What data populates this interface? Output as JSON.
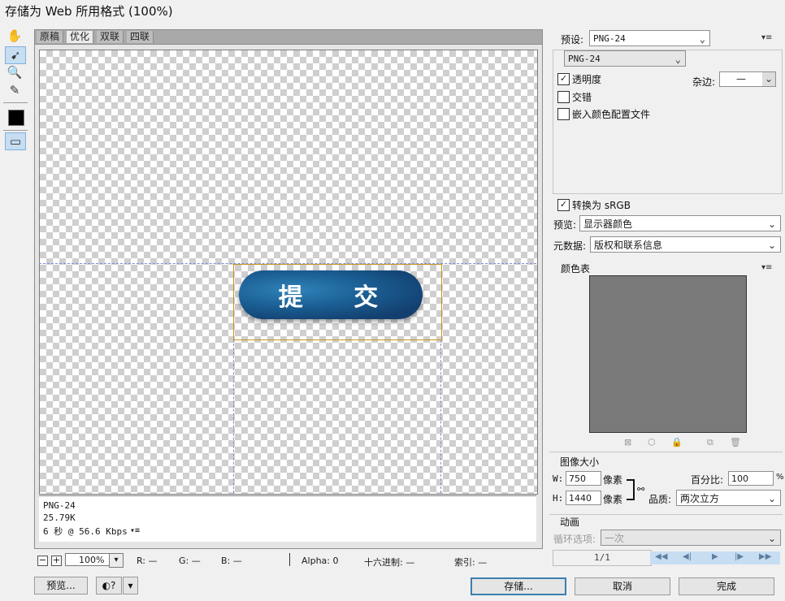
{
  "window": {
    "title": "存储为 Web 所用格式 (100%)"
  },
  "tabs": [
    {
      "label": "原稿",
      "active": false
    },
    {
      "label": "优化",
      "active": true
    },
    {
      "label": "双联",
      "active": false
    },
    {
      "label": "四联",
      "active": false
    }
  ],
  "canvas": {
    "button_text": "提 交"
  },
  "info": {
    "format": "PNG-24",
    "size": "25.79K",
    "time": "6 秒 @ 56.6 Kbps"
  },
  "status": {
    "zoom": "100%",
    "r": "R: —",
    "g": "G: —",
    "b": "B: —",
    "alpha": "Alpha: 0",
    "hex": "十六进制: —",
    "index": "索引: —"
  },
  "buttons": {
    "preview": "预览...",
    "save": "存储...",
    "cancel": "取消",
    "done": "完成"
  },
  "settings": {
    "preset_label": "预设:",
    "preset_value": "PNG-24",
    "format_value": "PNG-24",
    "transparency_label": "透明度",
    "transparency_checked": true,
    "matte_label": "杂边:",
    "matte_value": "—",
    "interlaced_label": "交错",
    "interlaced_checked": false,
    "embed_profile_label": "嵌入颜色配置文件",
    "embed_profile_checked": false,
    "convert_srgb_label": "转换为 sRGB",
    "convert_srgb_checked": true,
    "preview_label": "预览:",
    "preview_value": "显示器颜色",
    "metadata_label": "元数据:",
    "metadata_value": "版权和联系信息"
  },
  "color_table": {
    "title": "颜色表"
  },
  "image_size": {
    "title": "图像大小",
    "w_label": "W:",
    "w_value": "750",
    "w_unit": "像素",
    "h_label": "H:",
    "h_value": "1440",
    "h_unit": "像素",
    "percent_label": "百分比:",
    "percent_value": "100",
    "percent_unit": "%",
    "quality_label": "品质:",
    "quality_value": "两次立方"
  },
  "animation": {
    "title": "动画",
    "loop_label": "循环选项:",
    "loop_value": "一次",
    "frame_counter": "1/1"
  },
  "colors": {
    "accent": "#3c7fb1",
    "slice": "#c8961e",
    "guide": "#7f8fd8"
  }
}
